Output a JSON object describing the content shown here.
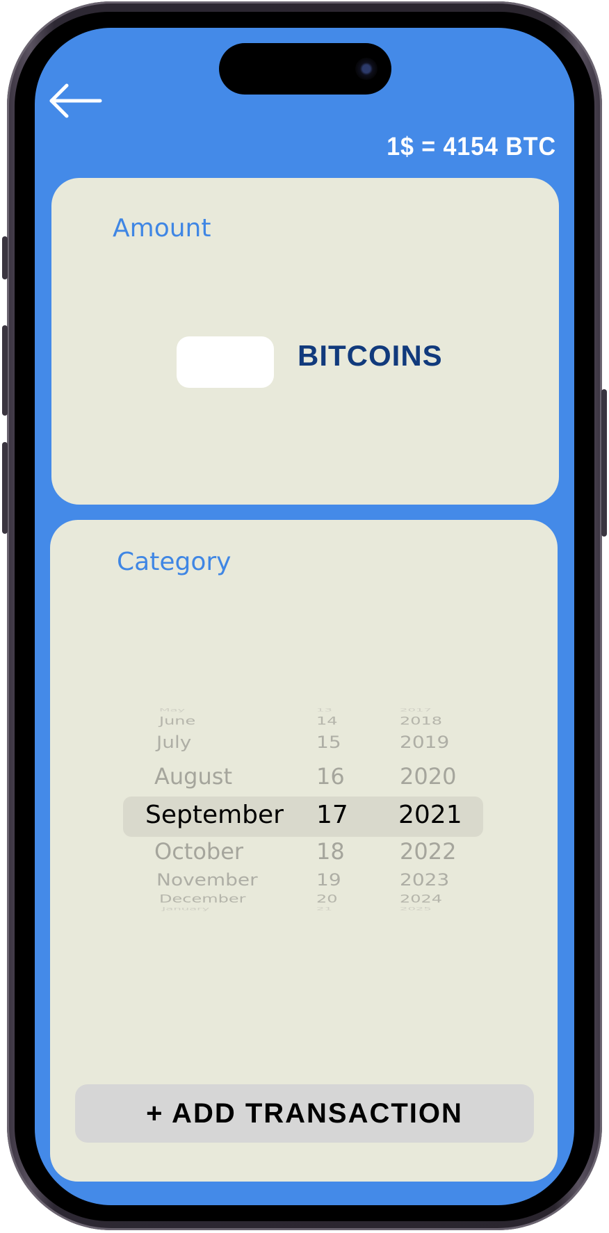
{
  "header": {
    "back_icon": "arrow-left-icon",
    "exchange_rate": "1$ = 4154 BTC"
  },
  "amount_card": {
    "label": "Amount",
    "input_value": "",
    "unit": "BITCOINS"
  },
  "category_card": {
    "label": "Category",
    "date_picker": {
      "months": [
        "May",
        "June",
        "July",
        "August",
        "September",
        "October",
        "November",
        "December",
        "January"
      ],
      "days": [
        "13",
        "14",
        "15",
        "16",
        "17",
        "18",
        "19",
        "20",
        "21"
      ],
      "years": [
        "2017",
        "2018",
        "2019",
        "2020",
        "2021",
        "2022",
        "2023",
        "2024",
        "2025"
      ],
      "selected_month": "September",
      "selected_day": "17",
      "selected_year": "2021"
    },
    "add_button_label": "+ ADD TRANSACTION"
  },
  "colors": {
    "screen_background": "#448ae8",
    "card_background": "#e8e9da",
    "label_blue": "#3f86e4",
    "unit_dark_blue": "#113a7c",
    "button_background": "#d6d6d6"
  }
}
